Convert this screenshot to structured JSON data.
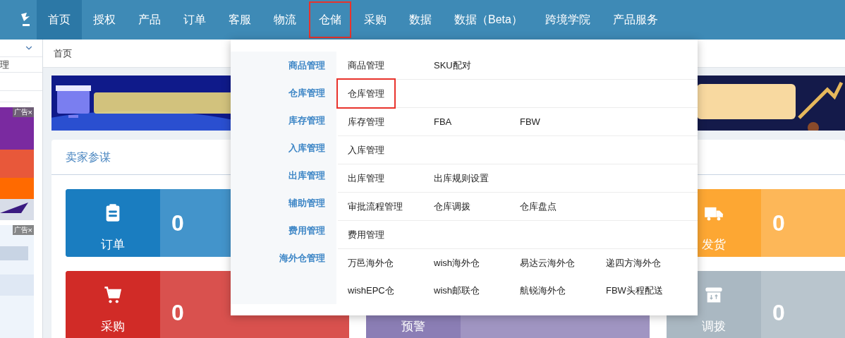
{
  "nav": {
    "items": [
      {
        "label": "首页",
        "selected": true,
        "highlighted": false
      },
      {
        "label": "授权",
        "selected": false,
        "highlighted": false
      },
      {
        "label": "产品",
        "selected": false,
        "highlighted": false
      },
      {
        "label": "订单",
        "selected": false,
        "highlighted": false
      },
      {
        "label": "客服",
        "selected": false,
        "highlighted": false
      },
      {
        "label": "物流",
        "selected": false,
        "highlighted": false
      },
      {
        "label": "仓储",
        "selected": false,
        "highlighted": true
      },
      {
        "label": "采购",
        "selected": false,
        "highlighted": false
      },
      {
        "label": "数据",
        "selected": false,
        "highlighted": false
      },
      {
        "label": "数据（Beta）",
        "selected": false,
        "highlighted": false
      },
      {
        "label": "跨境学院",
        "selected": false,
        "highlighted": false
      },
      {
        "label": "产品服务",
        "selected": false,
        "highlighted": false
      }
    ]
  },
  "sidebar": {
    "item": "理",
    "ads": [
      {
        "label": "广告",
        "close": "×"
      },
      {
        "label": "广告",
        "close": "×"
      }
    ]
  },
  "breadcrumb": "首页",
  "card": {
    "title": "卖家参谋",
    "rows": [
      [
        {
          "kind": "order",
          "label": "订单",
          "value": "0",
          "color": "#1a7dc0"
        },
        null,
        {
          "kind": "shipping",
          "label": "发货",
          "value": "0",
          "color": "#fda733"
        }
      ],
      [
        {
          "kind": "purchase",
          "label": "采购",
          "value": "0",
          "color": "#d12b27"
        },
        {
          "kind": "alert",
          "label": "预警",
          "color": "#8b7eb5"
        },
        {
          "kind": "transfer",
          "label": "调拨",
          "value": "0",
          "color": "#aab8c2"
        }
      ]
    ]
  },
  "dropdown": {
    "groups": [
      {
        "category": "商品管理",
        "items": [
          {
            "label": "商品管理",
            "highlighted": false
          },
          {
            "label": "SKU配对",
            "highlighted": false
          }
        ]
      },
      {
        "category": "仓库管理",
        "items": [
          {
            "label": "仓库管理",
            "highlighted": true
          }
        ]
      },
      {
        "category": "库存管理",
        "items": [
          {
            "label": "库存管理",
            "highlighted": false
          },
          {
            "label": "FBA",
            "highlighted": false
          },
          {
            "label": "FBW",
            "highlighted": false
          }
        ]
      },
      {
        "category": "入库管理",
        "items": [
          {
            "label": "入库管理",
            "highlighted": false
          }
        ]
      },
      {
        "category": "出库管理",
        "items": [
          {
            "label": "出库管理",
            "highlighted": false
          },
          {
            "label": "出库规则设置",
            "highlighted": false
          }
        ]
      },
      {
        "category": "辅助管理",
        "items": [
          {
            "label": "审批流程管理",
            "highlighted": false
          },
          {
            "label": "仓库调拨",
            "highlighted": false
          },
          {
            "label": "仓库盘点",
            "highlighted": false
          }
        ]
      },
      {
        "category": "费用管理",
        "items": [
          {
            "label": "费用管理",
            "highlighted": false
          }
        ]
      },
      {
        "category": "海外仓管理",
        "items": [
          {
            "label": "万邑海外仓",
            "highlighted": false
          },
          {
            "label": "wish海外仓",
            "highlighted": false
          },
          {
            "label": "易达云海外仓",
            "highlighted": false
          },
          {
            "label": "递四方海外仓",
            "highlighted": false
          },
          {
            "label": "wishEPC仓",
            "highlighted": false
          },
          {
            "label": "wish邮联仓",
            "highlighted": false
          },
          {
            "label": "航锐海外仓",
            "highlighted": false
          },
          {
            "label": "FBW头程配送",
            "highlighted": false
          }
        ]
      }
    ]
  }
}
